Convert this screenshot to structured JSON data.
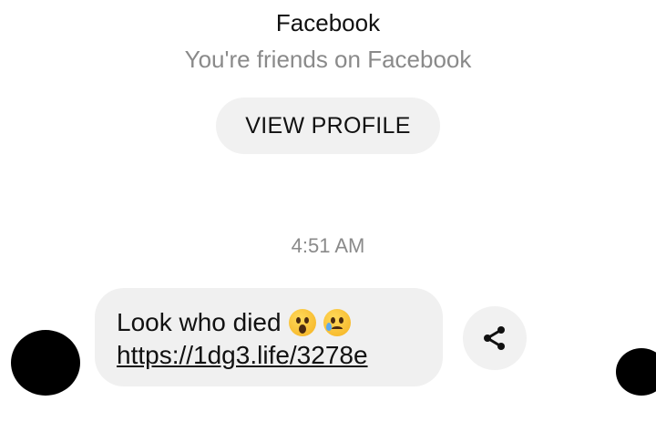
{
  "header": {
    "title": "Facebook",
    "subtitle": "You're friends on Facebook"
  },
  "profile_button": {
    "label": "VIEW PROFILE"
  },
  "conversation": {
    "timestamp": "4:51 AM",
    "message": {
      "text": "Look who died",
      "emojis": [
        "face-with-open-mouth",
        "sad-but-relieved-face"
      ],
      "link": "https://1dg3.life/3278e"
    }
  },
  "icons": {
    "share": "share-icon"
  },
  "colors": {
    "bubble": "#f0f0f0",
    "secondary_text": "#8a8a8a",
    "redaction": "#000000"
  }
}
